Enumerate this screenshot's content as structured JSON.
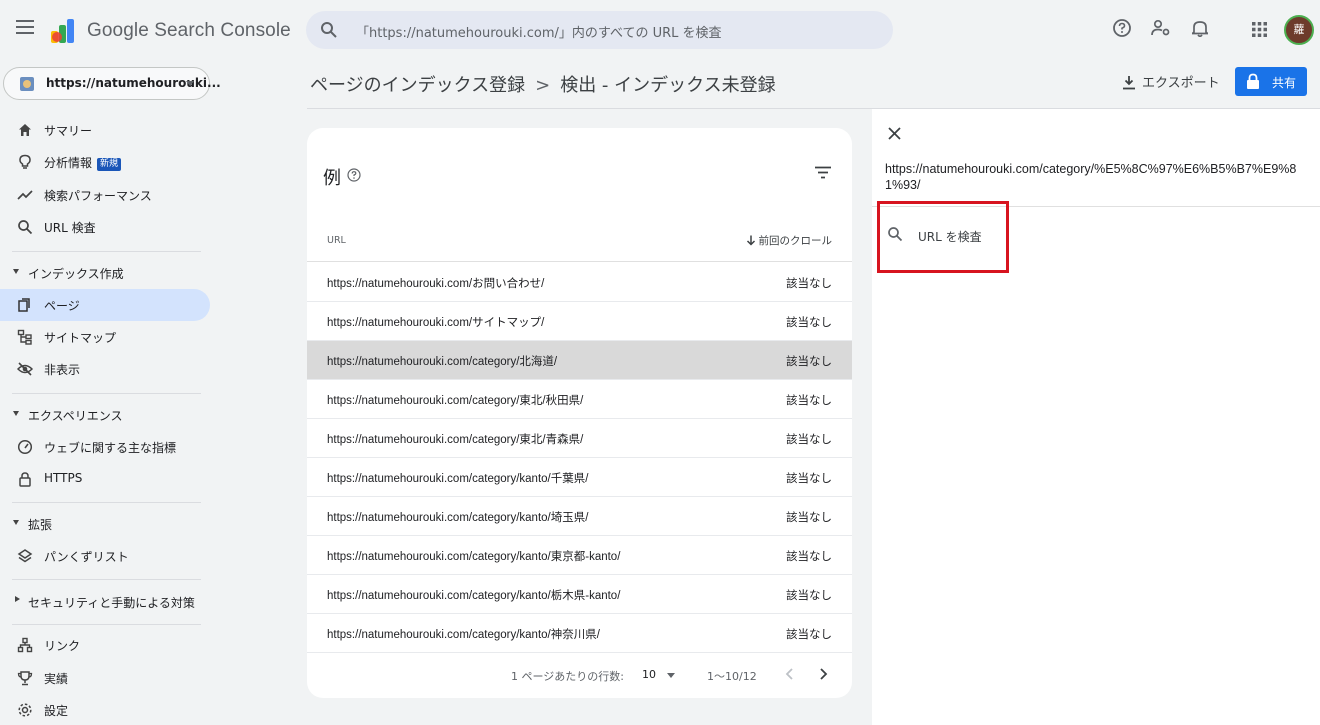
{
  "header": {
    "brand": "Google Search Console",
    "search_placeholder": "「https://natumehourouki.com/」内のすべての URL を検査",
    "avatar_initial": "蘿"
  },
  "property": {
    "label": "https://natumehourouki..."
  },
  "sidebar": {
    "items": [
      {
        "label": "サマリー",
        "icon": "home-icon"
      },
      {
        "label": "分析情報",
        "badge": "新規",
        "icon": "lightbulb-icon"
      },
      {
        "label": "検索パフォーマンス",
        "icon": "trend-icon"
      },
      {
        "label": "URL 検査",
        "icon": "search-icon"
      }
    ],
    "section_index": {
      "label": "インデックス作成"
    },
    "index_items": [
      {
        "label": "ページ",
        "icon": "pages-icon",
        "active": true
      },
      {
        "label": "サイトマップ",
        "icon": "sitemap-icon"
      },
      {
        "label": "非表示",
        "icon": "hidden-icon"
      }
    ],
    "section_experience": {
      "label": "エクスペリエンス"
    },
    "experience_items": [
      {
        "label": "ウェブに関する主な指標",
        "icon": "gauge-icon"
      },
      {
        "label": "HTTPS",
        "icon": "lock-icon"
      }
    ],
    "section_enhance": {
      "label": "拡張"
    },
    "enhance_items": [
      {
        "label": "パンくずリスト",
        "icon": "breadcrumb-icon"
      }
    ],
    "section_security": {
      "label": "セキュリティと手動による対策"
    },
    "bottom_items": [
      {
        "label": "リンク",
        "icon": "links-icon"
      },
      {
        "label": "実績",
        "icon": "trophy-icon"
      },
      {
        "label": "設定",
        "icon": "gear-icon"
      }
    ]
  },
  "breadcrumb": {
    "root": "ページのインデックス登録",
    "separator": ">",
    "current": "検出 - インデックス未登録"
  },
  "actions": {
    "export": "エクスポート",
    "share": "共有"
  },
  "card": {
    "title": "例",
    "columns": {
      "url": "URL",
      "crawl": "前回のクロール"
    },
    "rows": [
      {
        "url": "https://natumehourouki.com/お問い合わせ/",
        "crawl": "該当なし"
      },
      {
        "url": "https://natumehourouki.com/サイトマップ/",
        "crawl": "該当なし"
      },
      {
        "url": "https://natumehourouki.com/category/北海道/",
        "crawl": "該当なし",
        "selected": true
      },
      {
        "url": "https://natumehourouki.com/category/東北/秋田県/",
        "crawl": "該当なし"
      },
      {
        "url": "https://natumehourouki.com/category/東北/青森県/",
        "crawl": "該当なし"
      },
      {
        "url": "https://natumehourouki.com/category/kanto/千葉県/",
        "crawl": "該当なし"
      },
      {
        "url": "https://natumehourouki.com/category/kanto/埼玉県/",
        "crawl": "該当なし"
      },
      {
        "url": "https://natumehourouki.com/category/kanto/東京都-kanto/",
        "crawl": "該当なし"
      },
      {
        "url": "https://natumehourouki.com/category/kanto/栃木県-kanto/",
        "crawl": "該当なし"
      },
      {
        "url": "https://natumehourouki.com/category/kanto/神奈川県/",
        "crawl": "該当なし"
      }
    ],
    "pagination": {
      "rows_label": "1 ページあたりの行数:",
      "rows_value": "10",
      "range": "1～10/12"
    }
  },
  "panel": {
    "url": "https://natumehourouki.com/category/%E5%8C%97%E6%B5%B7%E9%81%93/",
    "inspect_label": "URL を検査",
    "highlight_color": "#d7141f"
  },
  "colors": {
    "accent": "#1a73e8",
    "active_nav": "#d3e3fd",
    "selected_row": "#d9d9d9"
  }
}
